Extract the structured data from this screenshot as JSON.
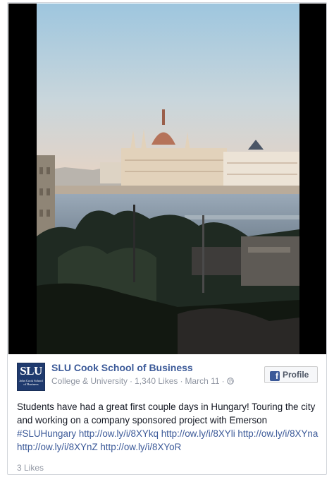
{
  "page": {
    "logo_text": "SLU",
    "logo_subtext": "John Cook School of Business",
    "name": "SLU Cook School of Business",
    "category": "College & University",
    "likes": "1,340 Likes",
    "date": "March 11",
    "separator": "·"
  },
  "profile_button": {
    "icon": "f",
    "label": "Profile"
  },
  "post": {
    "text": "Students have had a great first couple days in Hungary! Touring the city and working on a company sponsored project with Emerson ",
    "hashtag": "#SLUHungary",
    "links": [
      "http://ow.ly/i/8XYkq",
      "http://ow.ly/i/8XYli",
      "http://ow.ly/i/8XYna",
      "http://ow.ly/i/8XYnZ",
      "http://ow.ly/i/8XYoR"
    ]
  },
  "footer": {
    "likes": "3 Likes"
  },
  "colors": {
    "link": "#3b5998",
    "meta": "#9197a3",
    "logo_bg": "#1f3a6e"
  }
}
